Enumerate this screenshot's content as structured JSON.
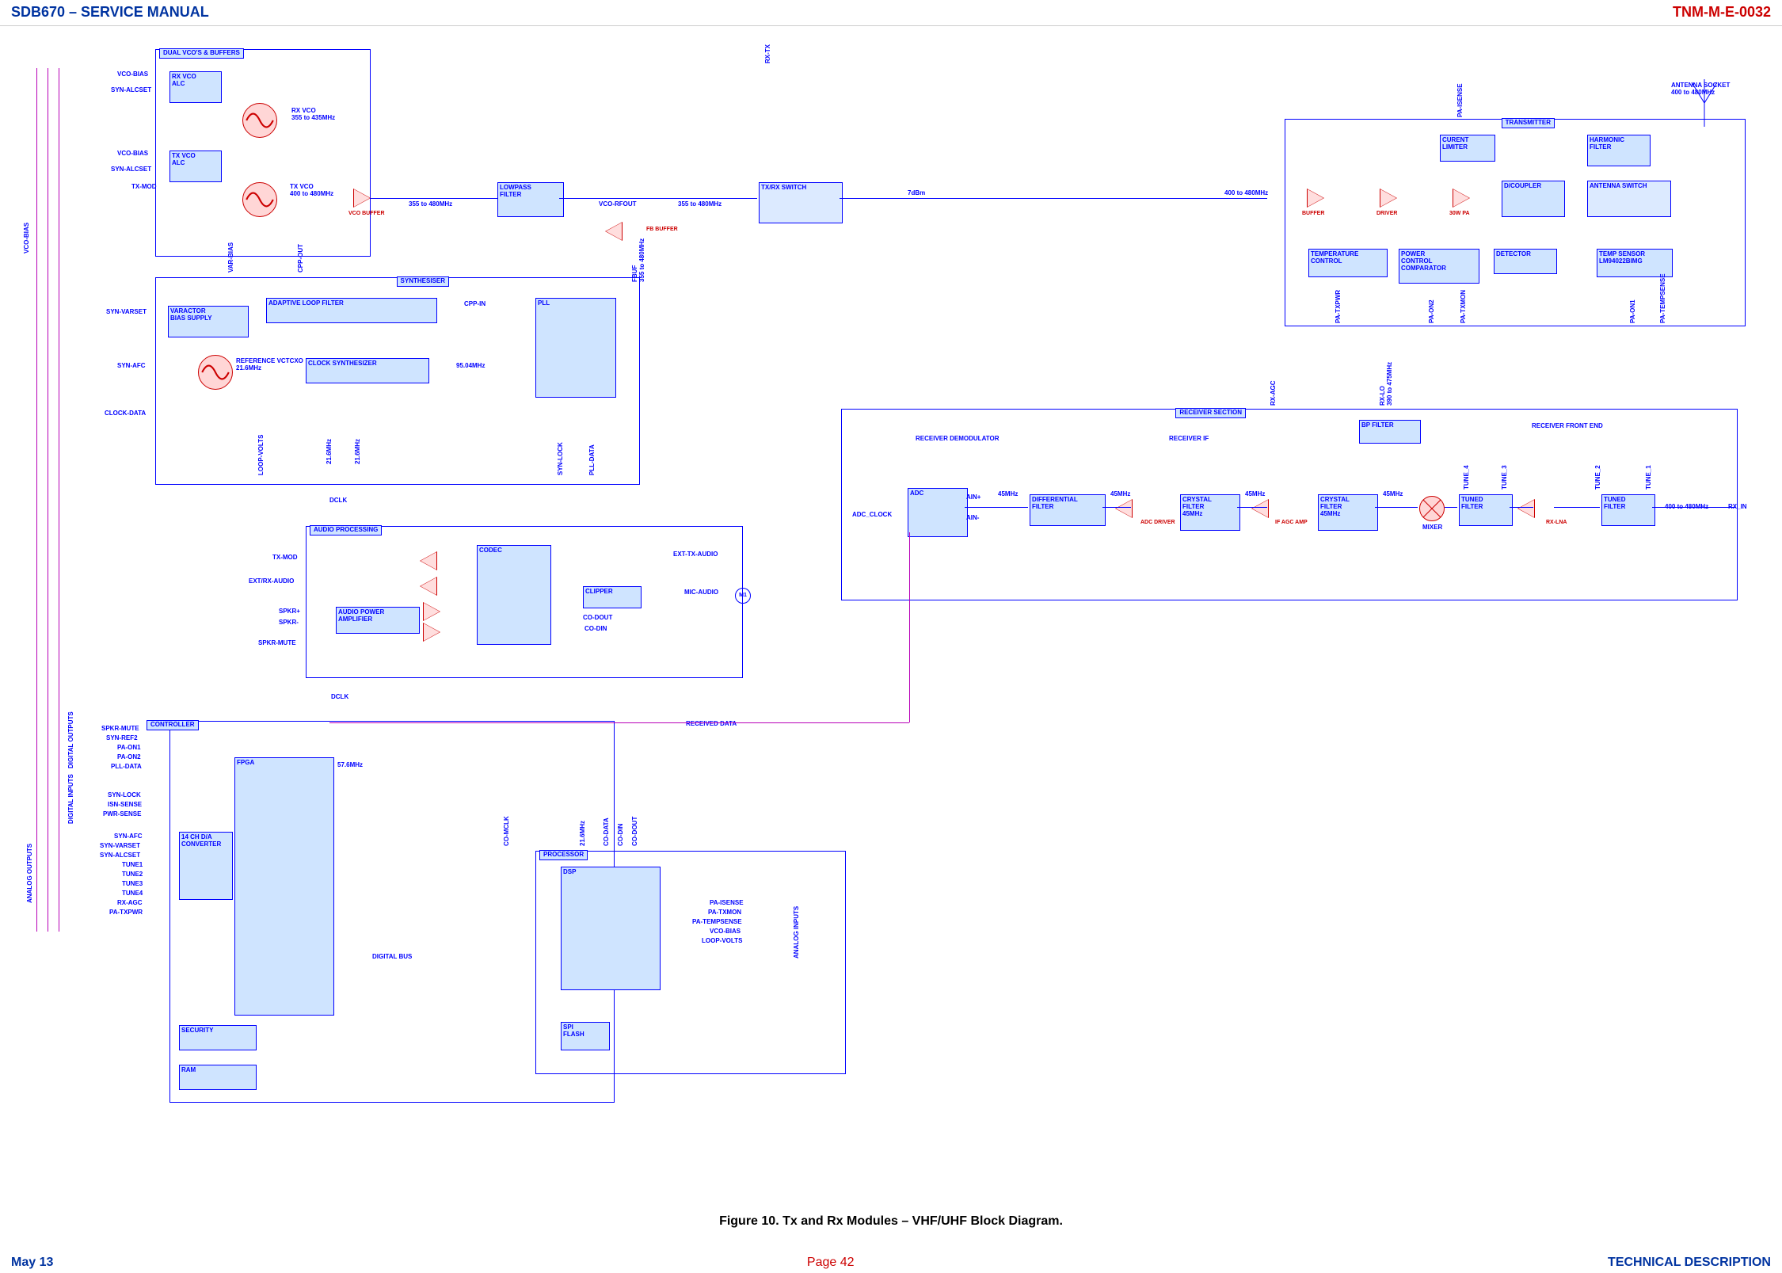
{
  "header": {
    "left": "SDB670 – SERVICE MANUAL",
    "right": "TNM-M-E-0032"
  },
  "footer": {
    "left": "May 13",
    "center": "Page 42",
    "right": "TECHNICAL DESCRIPTION"
  },
  "caption": "Figure 10.  Tx and Rx Modules – VHF/UHF Block Diagram.",
  "regions": {
    "vco": "DUAL VCO'S & BUFFERS",
    "synth": "SYNTHESISER",
    "audio": "AUDIO PROCESSING",
    "controller": "CONTROLLER",
    "processor": "PROCESSOR",
    "tx": "TRANSMITTER",
    "rx": "RECEIVER SECTION",
    "rx_front": "RECEIVER FRONT END"
  },
  "signals": {
    "vco_bias": "VCO-BIAS",
    "syn_alcset": "SYN-ALCSET",
    "tx_mod_left": "TX-MOD",
    "rxvco": "RX VCO\n355 to 435MHz",
    "txvco": "TX VCO\n400 to 480MHz",
    "vco_buffer": "VCO BUFFER",
    "vco_rfout": "VCO-RFOUT",
    "fbuffer": "FB BUFFER",
    "lp_span": "355 to 480MHz",
    "lp_span2": "355 to 480MHz",
    "seven_dbm": "7dBm",
    "freqspan": "400 to 480MHz",
    "rx_tx": "RX-TX",
    "var_bias": "VAR-BIAS",
    "cpp_out": "CPP-OUT",
    "fbuf": "FBUF\n355 to 480MHz",
    "syn_varset": "SYN-VARSET",
    "syn_afc": "SYN-AFC",
    "clock_data": "CLOCK-DATA",
    "ref": "REFERENCE VCTCXO\n21.6MHz",
    "cpp_in": "CPP-IN",
    "osc95": "95.04MHz",
    "mhz216a": "21.6MHz",
    "mhz216b": "21.6MHz",
    "loop_volts": "LOOP-VOLTS",
    "syn_lock": "SYN-LOCK",
    "pll_data": "PLL-DATA",
    "dclk": "DCLK",
    "dclk2": "DCLK",
    "tx_mod": "TX-MOD",
    "ext_rx_audio": "EXT/RX-AUDIO",
    "spkr_plus": "SPKR+",
    "spkr_minus": "SPKR-",
    "spkr_mute": "SPKR-MUTE",
    "ext_tx_audio": "EXT-TX-AUDIO",
    "mic_audio": "MIC-AUDIO",
    "mic": "M1",
    "co_dout": "CO-DOUT",
    "co_din": "CO-DIN",
    "co_mclk": "CO-MCLK",
    "co_data": "CO-DATA",
    "co_din2": "CO-DIN",
    "co_dout2": "CO-DOUT",
    "mhz576": "57.6MHz",
    "digital_bus": "DIGITAL BUS",
    "received_data": "RECEIVED DATA",
    "pa_isense": "PA-ISENSE",
    "pa_txmon": "PA-TXMON",
    "pa_tempsense": "PA-TEMPSENSE",
    "vco_bias2": "VCO-BIAS",
    "loop_volts2": "LOOP-VOLTS",
    "analog_inputs": "ANALOG INPUTS",
    "analog_outputs": "ANALOG OUTPUTS",
    "digital_inputs": "DIGITAL INPUTS",
    "digital_outputs": "DIGITAL OUTPUTS",
    "ant_socket": "ANTENNA SOCKET\n400 to 480MHz",
    "pa_txpwr": "PA-TXPWR",
    "pa_on2": "PA-ON2",
    "pa_txmon2": "PA-TXMON",
    "pa_on1": "PA-ON1",
    "pa_tempsense2": "PA-TEMPSENSE",
    "rx_agc": "RX-AGC",
    "rx_lo": "RX-LO\n390 to 475MHz",
    "rx_demod": "RECEIVER DEMODULATOR",
    "rx_if": "RECEIVER IF",
    "rx_front": "RECEIVER FRONT END",
    "mhz45a": "45MHz",
    "mhz45b": "45MHz",
    "mhz45c": "45MHz",
    "mhz45d": "45MHz",
    "tune1": "TUNE_1",
    "tune2": "TUNE_2",
    "tune3": "TUNE_3",
    "tune4": "TUNE_4",
    "adc_clock": "ADC_CLOCK",
    "ain_p": "AIN+",
    "ain_n": "AIN-",
    "fourhundred": "400 to 480MHz",
    "rx_in": "RX_IN",
    "mixer": "MIXER",
    "ctrl_spkr_mute": "SPKR-MUTE",
    "ctrl_synref2": "SYN-REF2",
    "ctrl_paon1": "PA-ON1",
    "ctrl_paon2": "PA-ON2",
    "ctrl_plldata": "PLL-DATA",
    "ctrl_synlock": "SYN-LOCK",
    "ctrl_isense": "ISN-SENSE",
    "ctrl_pwrsense": "PWR-SENSE",
    "ctrl_synafc": "SYN-AFC",
    "ctrl_synvarset": "SYN-VARSET",
    "ctrl_synalcset": "SYN-ALCSET",
    "ctrl_tune1": "TUNE1",
    "ctrl_tune2": "TUNE2",
    "ctrl_tune3": "TUNE3",
    "ctrl_tune4": "TUNE4",
    "ctrl_rxagc": "RX-AGC",
    "ctrl_patxpwr": "PA-TXPWR"
  },
  "blocks": {
    "rx_vco_alc": "RX VCO\nALC",
    "tx_vco_alc": "TX VCO\nALC",
    "lowpass": "LOWPASS\nFILTER",
    "txrx_switch": "TX/RX SWITCH",
    "varactor": "VARACTOR\nBIAS SUPPLY",
    "loopfilter": "ADAPTIVE LOOP FILTER",
    "pll": "PLL",
    "clock_synth": "CLOCK SYNTHESIZER",
    "codec": "CODEC",
    "clipper": "CLIPPER",
    "apa": "AUDIO POWER\nAMPLIFIER",
    "fpga": "FPGA",
    "dac14": "14 CH D/A\nCONVERTER",
    "security": "SECURITY",
    "ram": "RAM",
    "dsp": "DSP",
    "spiflash": "SPI\nFLASH",
    "buffer": "BUFFER",
    "driver": "DRIVER",
    "thirtyw": "30W PA",
    "dcoupler": "D/COUPLER",
    "currlim": "CURENT\nLIMITER",
    "harmonic": "HARMONIC\nFILTER",
    "ant_switch": "ANTENNA SWITCH",
    "tempctrl": "TEMPERATURE\nCONTROL",
    "pwrcomp": "POWER\nCONTROL\nCOMPARATOR",
    "detector": "DETECTOR",
    "tempsensor": "TEMP SENSOR\nLM94022BIMG",
    "adc": "ADC",
    "diff": "DIFFERENTIAL\nFILTER",
    "adc_driver": "ADC DRIVER",
    "xf1": "CRYSTAL\nFILTER\n45MHz",
    "if_agc": "IF AGC AMP",
    "xf2": "CRYSTAL\nFILTER\n45MHz",
    "bpfilter": "BP FILTER",
    "tuned3": "TUNED\nFILTER",
    "rx_lna": "RX-LNA",
    "tuned1": "TUNED\nFILTER"
  }
}
